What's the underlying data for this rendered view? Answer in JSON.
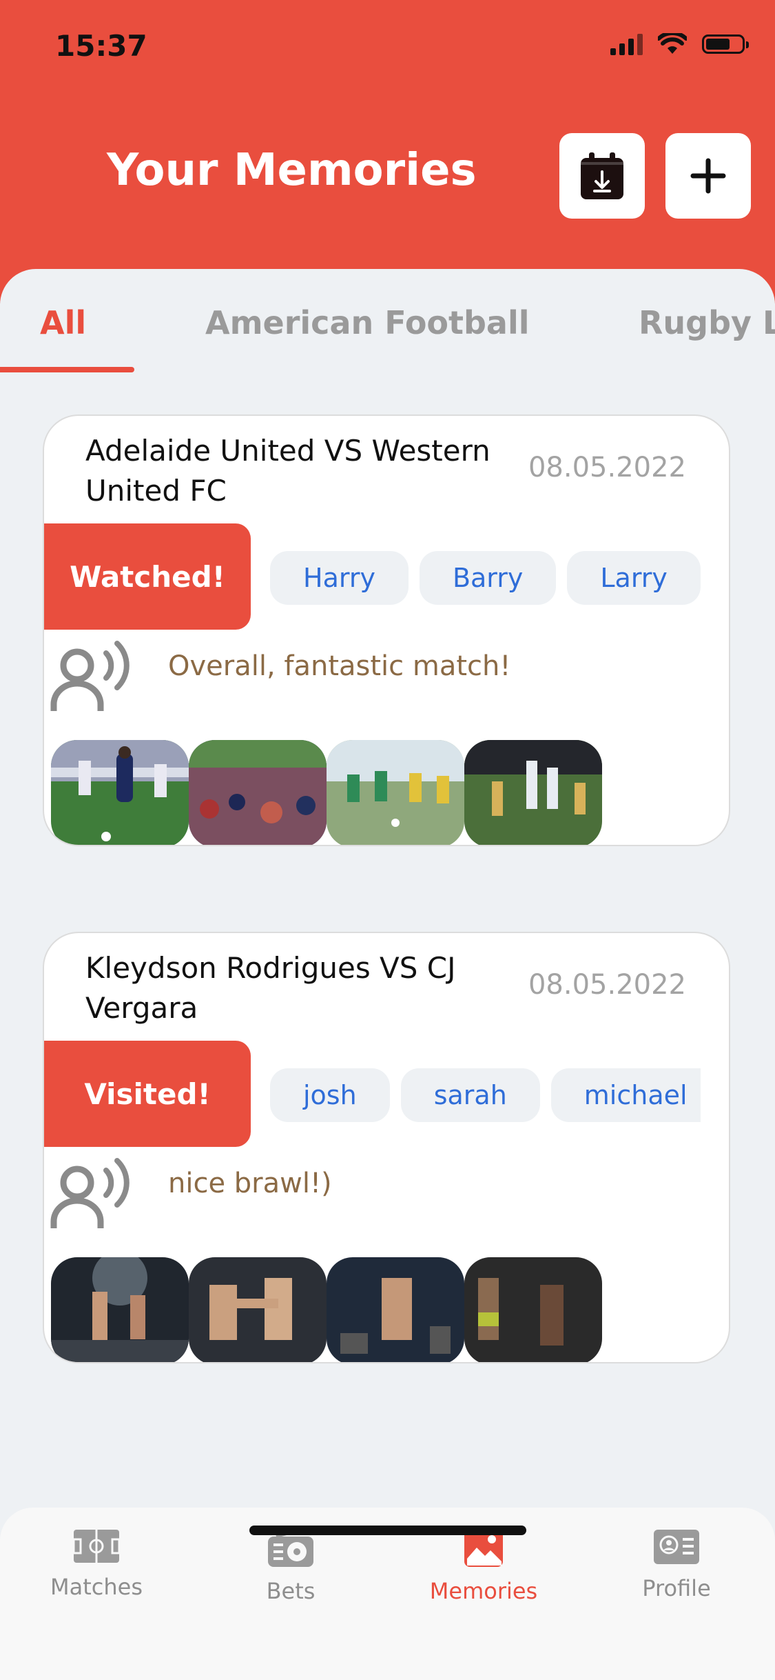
{
  "status_bar": {
    "time": "15:37"
  },
  "header": {
    "title": "Your Memories"
  },
  "tabs": [
    {
      "label": "All",
      "active": true
    },
    {
      "label": "American Football",
      "active": false
    },
    {
      "label": "Rugby Le",
      "active": false
    }
  ],
  "memories": [
    {
      "title": "Adelaide United VS Western United FC",
      "date": "08.05.2022",
      "status": "Watched!",
      "people": [
        "Harry",
        "Barry",
        "Larry"
      ],
      "note": "Overall, fantastic match!",
      "photos": [
        "soccer-match-photo",
        "stadium-crowd-photo",
        "kids-soccer-photo",
        "aussie-rules-photo"
      ]
    },
    {
      "title": "Kleydson Rodrigues VS CJ Vergara",
      "date": "08.05.2022",
      "status": "Visited!",
      "people": [
        "josh",
        "sarah",
        "michael"
      ],
      "note": "nice brawl!)",
      "photos": [
        "kickboxing-photo",
        "mma-kick-photo",
        "ufc-fighter-photo",
        "cage-fight-photo"
      ]
    }
  ],
  "bottom_nav": [
    {
      "label": "Matches",
      "icon": "field-icon",
      "active": false
    },
    {
      "label": "Bets",
      "icon": "radio-ball-icon",
      "active": false
    },
    {
      "label": "Memories",
      "icon": "image-icon",
      "active": true
    },
    {
      "label": "Profile",
      "icon": "id-card-icon",
      "active": false
    }
  ],
  "colors": {
    "accent": "#E94E3E",
    "chip_text": "#2F6DD8",
    "note_text": "#8B6A45"
  }
}
